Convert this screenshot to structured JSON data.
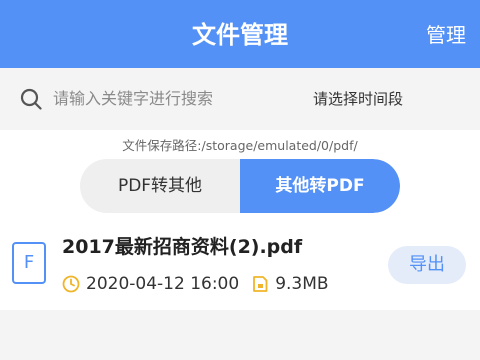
{
  "header": {
    "title": "文件管理",
    "manage_label": "管理"
  },
  "search": {
    "placeholder": "请输入关键字进行搜索",
    "time_range_label": "请选择时间段"
  },
  "storage": {
    "path_text": "文件保存路径:/storage/emulated/0/pdf/"
  },
  "tabs": [
    {
      "label": "PDF转其他",
      "active": false
    },
    {
      "label": "其他转PDF",
      "active": true
    }
  ],
  "files": [
    {
      "icon_letter": "F",
      "name": "2017最新招商资料(2).pdf",
      "datetime": "2020-04-12 16:00",
      "size": "9.3MB",
      "action_label": "导出"
    }
  ],
  "colors": {
    "accent": "#5391f6",
    "warning": "#f0b52a"
  },
  "icons": {
    "search": "search-icon",
    "clock": "clock-icon",
    "size": "file-size-icon"
  }
}
